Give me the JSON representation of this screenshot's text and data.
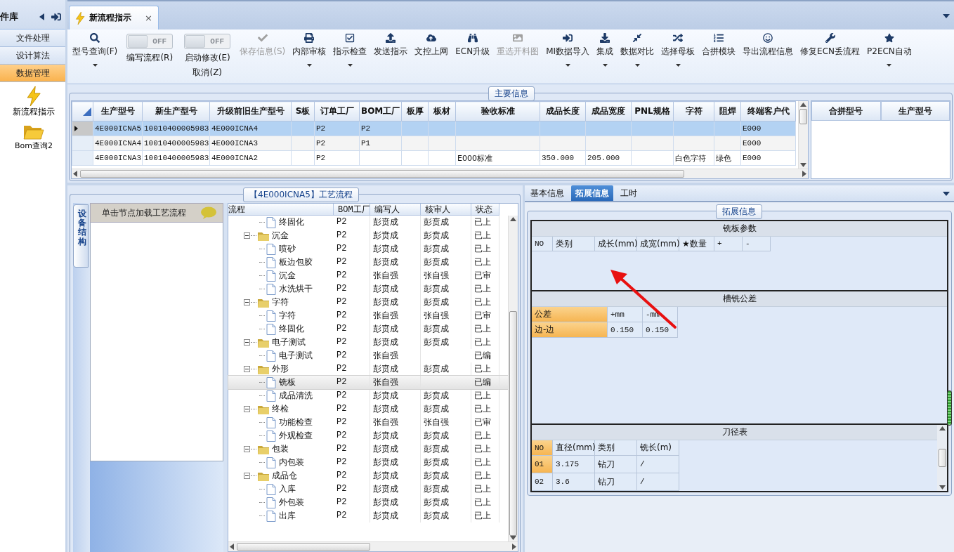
{
  "sidebar": {
    "title": "件库",
    "items": [
      {
        "label": "文件处理",
        "selected": false
      },
      {
        "label": "设计算法",
        "selected": false
      },
      {
        "label": "数据管理",
        "selected": true
      }
    ],
    "shortcuts": [
      {
        "label": "新流程指示",
        "kind": "lightning"
      },
      {
        "label": "Bom查询2",
        "kind": "folder"
      }
    ]
  },
  "document_tab": {
    "title": "新流程指示",
    "close": "×"
  },
  "toolbar": [
    {
      "kind": "button",
      "label": "型号查询(F)",
      "disabled": false,
      "dropdown": true
    },
    {
      "kind": "toggle",
      "label": "编写流程(R)",
      "on": false,
      "state_label": "OFF"
    },
    {
      "kind": "toggle",
      "label": "启动修改(E)",
      "sublabel": "取消(Z)",
      "on": false,
      "state_label": "OFF"
    },
    {
      "kind": "button",
      "label": "保存信息(S)",
      "disabled": true,
      "dropdown": false
    },
    {
      "kind": "button",
      "label": "内部审核",
      "disabled": false,
      "dropdown": true
    },
    {
      "kind": "button",
      "label": "指示检查",
      "disabled": false,
      "dropdown": true
    },
    {
      "kind": "button",
      "label": "发送指示",
      "disabled": false,
      "dropdown": false
    },
    {
      "kind": "button",
      "label": "文控上网",
      "disabled": false,
      "dropdown": false
    },
    {
      "kind": "button",
      "label": "ECN升级",
      "disabled": false,
      "dropdown": false
    },
    {
      "kind": "button",
      "label": "重选开料图",
      "disabled": true,
      "dropdown": false
    },
    {
      "kind": "button",
      "label": "MI数据导入",
      "disabled": false,
      "dropdown": true
    },
    {
      "kind": "button",
      "label": "集成",
      "disabled": false,
      "dropdown": true
    },
    {
      "kind": "button",
      "label": "数据对比",
      "disabled": false,
      "dropdown": true
    },
    {
      "kind": "button",
      "label": "选择母板",
      "disabled": false,
      "dropdown": true
    },
    {
      "kind": "button",
      "label": "合拼模块",
      "disabled": false,
      "dropdown": false
    },
    {
      "kind": "button",
      "label": "导出流程信息",
      "disabled": false,
      "dropdown": false
    },
    {
      "kind": "button",
      "label": "修复ECN丢流程",
      "disabled": false,
      "dropdown": false
    },
    {
      "kind": "button",
      "label": "P2ECN自动",
      "disabled": false,
      "dropdown": true
    }
  ],
  "main_info": {
    "title": "主要信息",
    "table": {
      "columns": [
        "生产型号",
        "新生产型号",
        "升级前旧生产型号",
        "S板",
        "订单工厂",
        "BOM工厂",
        "板厚",
        "板材",
        "验收标准",
        "成品长度",
        "成品宽度",
        "PNL规格",
        "字符",
        "阻焊",
        "终端客户代"
      ],
      "rows": [
        {
          "selected": true,
          "cells": [
            "4E000ICNA5",
            "10010400005983",
            "4E000ICNA4",
            null,
            "P2",
            "P2",
            null,
            null,
            null,
            null,
            null,
            null,
            null,
            null,
            "E000"
          ]
        },
        {
          "selected": false,
          "cells": [
            "4E000ICNA4",
            "10010400005983",
            "4E000ICNA3",
            null,
            "P2",
            "P1",
            null,
            null,
            null,
            null,
            null,
            null,
            null,
            null,
            "E000"
          ]
        },
        {
          "selected": false,
          "cells": [
            "4E000ICNA3",
            "10010400005983",
            "4E000ICNA2",
            null,
            "P2",
            null,
            null,
            null,
            "E000标准",
            "350.000",
            "205.000",
            null,
            "白色字符",
            "绿色",
            "E000"
          ]
        }
      ]
    },
    "merge_table": {
      "columns": [
        "合拼型号",
        "生产型号"
      ]
    }
  },
  "process": {
    "title": "【4E000ICNA5】工艺流程",
    "side_tab": {
      "label": "设备结构",
      "selected": true
    },
    "hint": "单击节点加载工艺流程",
    "columns": [
      "流程",
      "BOM工厂",
      "编写人",
      "核审人",
      "状态"
    ],
    "tree": [
      {
        "kind": "file",
        "name": "终固化",
        "bom": "P2",
        "author": "彭贲成",
        "reviewer": "彭贲成",
        "status": "已上",
        "selected": false
      },
      {
        "kind": "folder",
        "name": "沉金",
        "bom": "P2",
        "author": "彭贲成",
        "reviewer": "彭贲成",
        "status": "已上",
        "selected": false,
        "expanded": true,
        "children": [
          {
            "kind": "file",
            "name": "喷砂",
            "bom": "P2",
            "author": "彭贲成",
            "reviewer": "彭贲成",
            "status": "已上",
            "selected": false
          },
          {
            "kind": "file",
            "name": "板边包胶",
            "bom": "P2",
            "author": "彭贲成",
            "reviewer": "彭贲成",
            "status": "已上",
            "selected": false
          },
          {
            "kind": "file",
            "name": "沉金",
            "bom": "P2",
            "author": "张自强",
            "reviewer": "张自强",
            "status": "已审",
            "selected": false
          },
          {
            "kind": "file",
            "name": "水洗烘干",
            "bom": "P2",
            "author": "彭贲成",
            "reviewer": "彭贲成",
            "status": "已上",
            "selected": false
          }
        ]
      },
      {
        "kind": "folder",
        "name": "字符",
        "bom": "P2",
        "author": "彭贲成",
        "reviewer": "彭贲成",
        "status": "已上",
        "selected": false,
        "expanded": true,
        "children": [
          {
            "kind": "file",
            "name": "字符",
            "bom": "P2",
            "author": "张自强",
            "reviewer": "张自强",
            "status": "已审",
            "selected": false
          },
          {
            "kind": "file",
            "name": "终固化",
            "bom": "P2",
            "author": "彭贲成",
            "reviewer": "彭贲成",
            "status": "已上",
            "selected": false
          }
        ]
      },
      {
        "kind": "folder",
        "name": "电子测试",
        "bom": "P2",
        "author": "彭贲成",
        "reviewer": "彭贲成",
        "status": "已上",
        "selected": false,
        "expanded": true,
        "children": [
          {
            "kind": "file",
            "name": "电子测试",
            "bom": "P2",
            "author": "张自强",
            "status": "已编",
            "selected": false
          }
        ]
      },
      {
        "kind": "folder",
        "name": "外形",
        "bom": "P2",
        "author": "彭贲成",
        "reviewer": "彭贲成",
        "status": "已上",
        "selected": false,
        "expanded": true,
        "children": [
          {
            "kind": "file",
            "name": "铣板",
            "bom": "P2",
            "author": "张自强",
            "status": "已编",
            "selected": true
          },
          {
            "kind": "file",
            "name": "成品清洗",
            "bom": "P2",
            "author": "彭贲成",
            "reviewer": "彭贲成",
            "status": "已上",
            "selected": false
          }
        ]
      },
      {
        "kind": "folder",
        "name": "终检",
        "bom": "P2",
        "author": "彭贲成",
        "reviewer": "彭贲成",
        "status": "已上",
        "selected": false,
        "expanded": true,
        "children": [
          {
            "kind": "file",
            "name": "功能检查",
            "bom": "P2",
            "author": "张自强",
            "reviewer": "张自强",
            "status": "已审",
            "selected": false
          },
          {
            "kind": "file",
            "name": "外观检查",
            "bom": "P2",
            "author": "彭贲成",
            "reviewer": "彭贲成",
            "status": "已上",
            "selected": false
          }
        ]
      },
      {
        "kind": "folder",
        "name": "包装",
        "bom": "P2",
        "author": "彭贲成",
        "reviewer": "彭贲成",
        "status": "已上",
        "selected": false,
        "expanded": true,
        "children": [
          {
            "kind": "file",
            "name": "内包装",
            "bom": "P2",
            "author": "彭贲成",
            "reviewer": "彭贲成",
            "status": "已上",
            "selected": false
          }
        ]
      },
      {
        "kind": "folder",
        "name": "成品仓",
        "bom": "P2",
        "author": "彭贲成",
        "reviewer": "彭贲成",
        "status": "已上",
        "selected": false,
        "expanded": true,
        "children": [
          {
            "kind": "file",
            "name": "入库",
            "bom": "P2",
            "author": "彭贲成",
            "reviewer": "彭贲成",
            "status": "已上",
            "selected": false
          },
          {
            "kind": "file",
            "name": "外包装",
            "bom": "P2",
            "author": "彭贲成",
            "reviewer": "彭贲成",
            "status": "已上",
            "selected": false
          },
          {
            "kind": "file",
            "name": "出库",
            "bom": "P2",
            "author": "彭贲成",
            "reviewer": "彭贲成",
            "status": "已上",
            "selected": false
          }
        ]
      }
    ]
  },
  "details": {
    "tabs": [
      {
        "label": "基本信息",
        "selected": false
      },
      {
        "label": "拓展信息",
        "selected": true
      },
      {
        "label": "工时",
        "selected": false
      }
    ],
    "group_title": "拓展信息",
    "sections": [
      {
        "kind": "params",
        "title": "铣板参数",
        "columns": [
          "NO",
          "类别",
          "成长(mm)",
          "成宽(mm)",
          "★数量",
          "+",
          "-"
        ]
      },
      {
        "kind": "tolerance",
        "title": "槽铣公差",
        "columns": [
          "公差",
          "+mm",
          "-mm"
        ],
        "rows": [
          {
            "cells": [
              "边-边",
              "0.150",
              "0.150"
            ]
          }
        ]
      },
      {
        "kind": "tools",
        "title": "刀径表",
        "columns": [
          "NO",
          "直径(mm)",
          "类别",
          "铣长(m)"
        ],
        "rows": [
          {
            "selected": true,
            "cells": [
              "01",
              "3.175",
              "钻刀",
              "/"
            ]
          },
          {
            "selected": false,
            "cells": [
              "02",
              "3.6",
              "钻刀",
              "/"
            ]
          }
        ]
      }
    ]
  }
}
